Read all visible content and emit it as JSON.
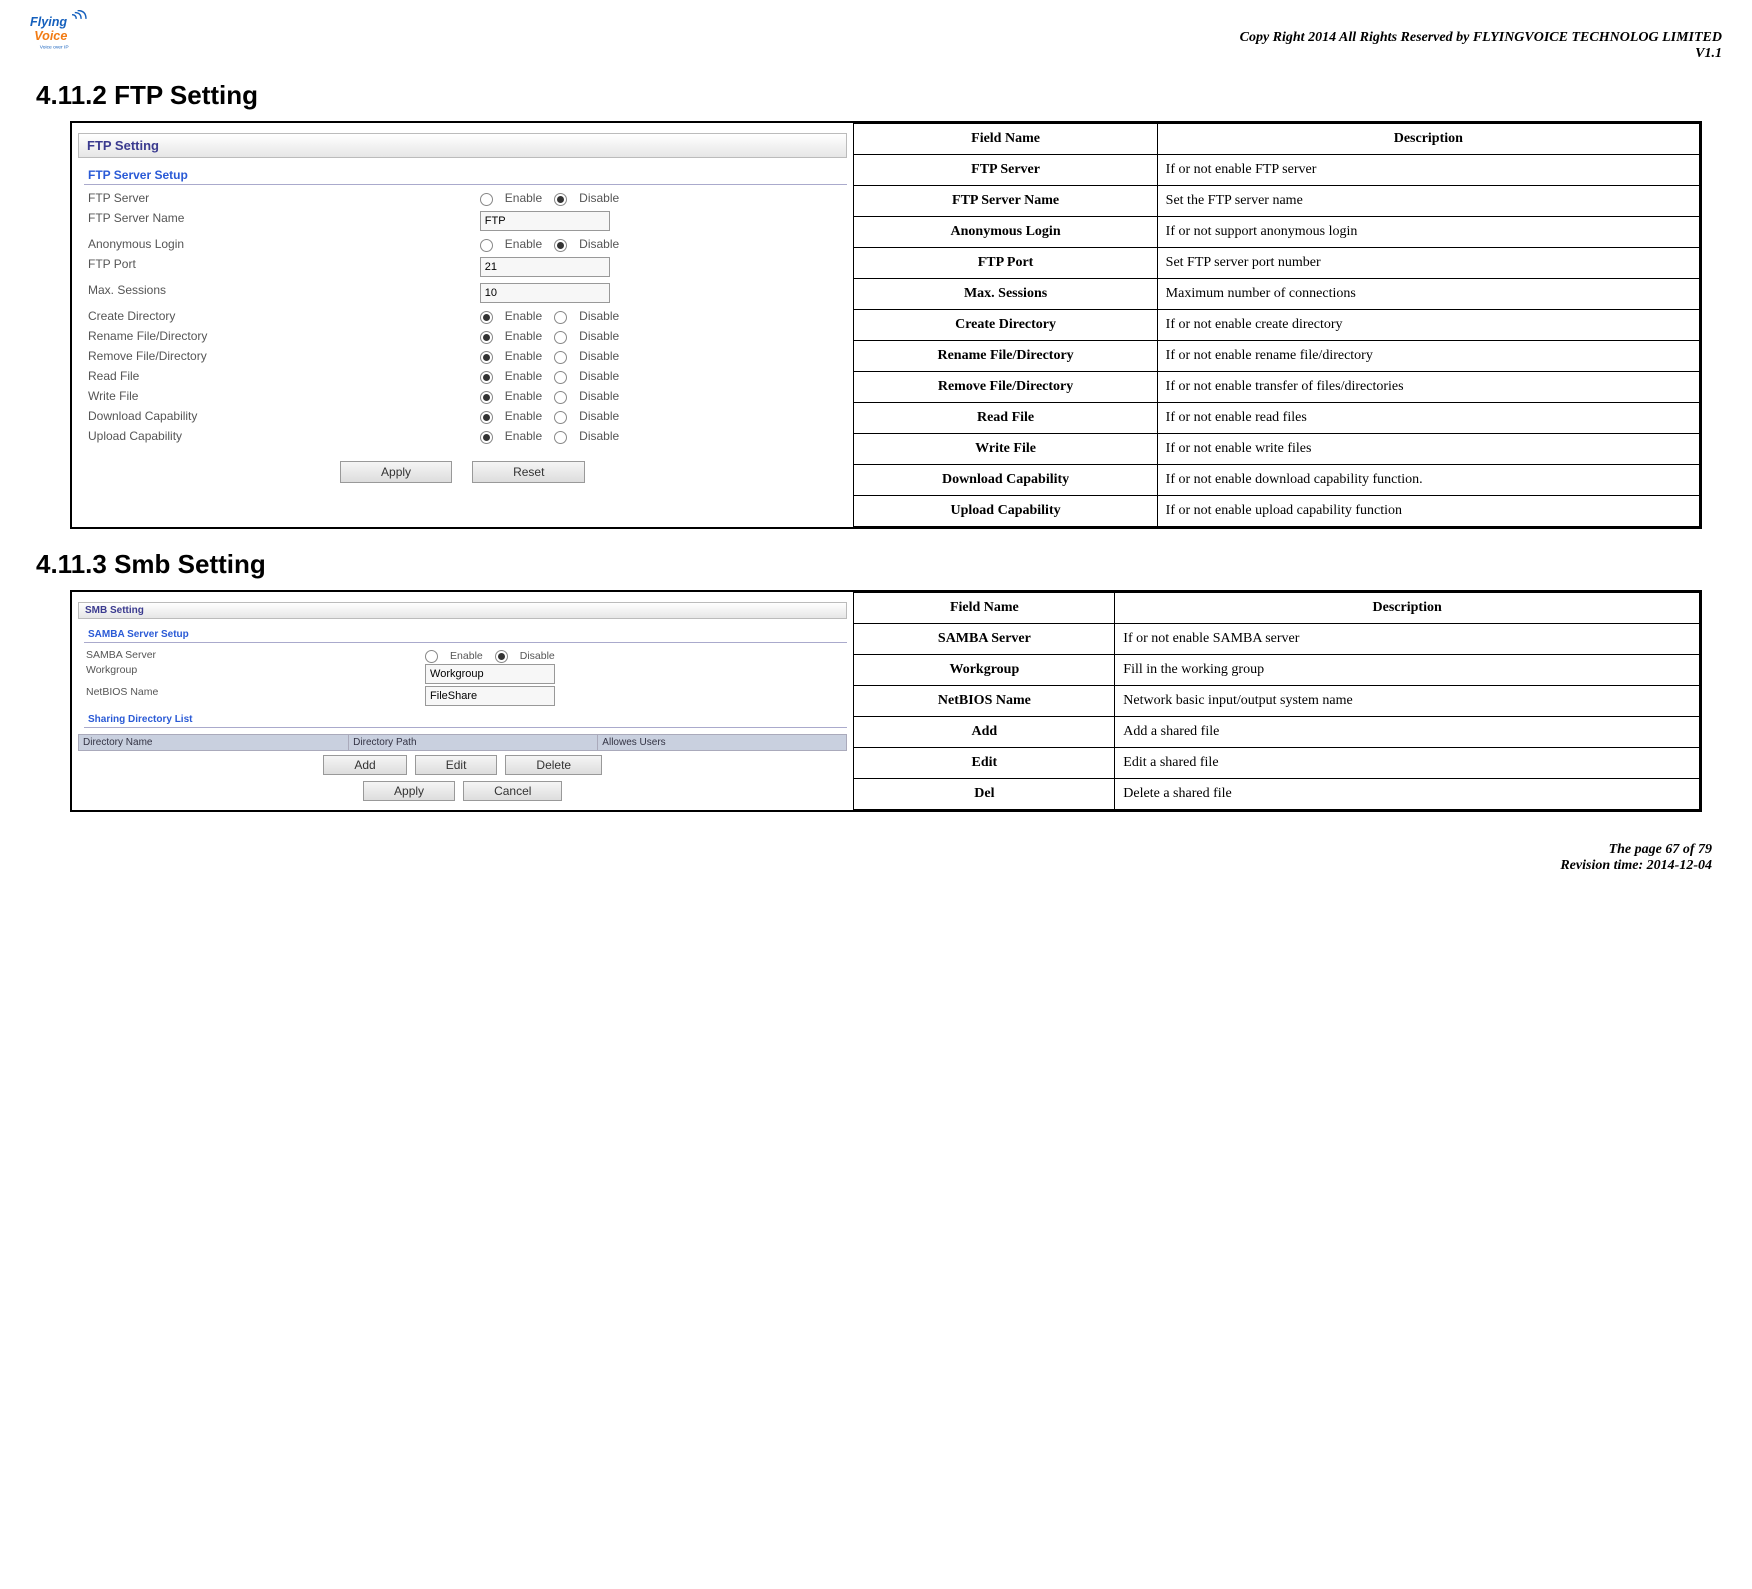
{
  "header": {
    "copyright": "Copy Right 2014 All Rights Reserved by FLYINGVOICE TECHNOLOG LIMITED",
    "version": "V1.1"
  },
  "section1": {
    "heading": "4.11.2  FTP Setting",
    "panel_title": "FTP Setting",
    "group_title": "FTP Server Setup",
    "rows": [
      {
        "label": "FTP Server",
        "enable": "Enable",
        "disable": "Disable",
        "type": "radio",
        "sel": "disable"
      },
      {
        "label": "FTP Server Name",
        "value": "FTP",
        "type": "text"
      },
      {
        "label": "Anonymous Login",
        "enable": "Enable",
        "disable": "Disable",
        "type": "radio",
        "sel": "disable"
      },
      {
        "label": "FTP Port",
        "value": "21",
        "type": "text"
      },
      {
        "label": "Max. Sessions",
        "value": "10",
        "type": "text"
      },
      {
        "label": "Create Directory",
        "enable": "Enable",
        "disable": "Disable",
        "type": "radio",
        "sel": "enable"
      },
      {
        "label": "Rename File/Directory",
        "enable": "Enable",
        "disable": "Disable",
        "type": "radio",
        "sel": "enable"
      },
      {
        "label": "Remove File/Directory",
        "enable": "Enable",
        "disable": "Disable",
        "type": "radio",
        "sel": "enable"
      },
      {
        "label": "Read File",
        "enable": "Enable",
        "disable": "Disable",
        "type": "radio",
        "sel": "enable"
      },
      {
        "label": "Write File",
        "enable": "Enable",
        "disable": "Disable",
        "type": "radio",
        "sel": "enable"
      },
      {
        "label": "Download Capability",
        "enable": "Enable",
        "disable": "Disable",
        "type": "radio",
        "sel": "enable"
      },
      {
        "label": "Upload Capability",
        "enable": "Enable",
        "disable": "Disable",
        "type": "radio",
        "sel": "enable"
      }
    ],
    "apply": "Apply",
    "reset": "Reset",
    "desc_header_field": "Field Name",
    "desc_header_desc": "Description",
    "desc_rows": [
      {
        "f": "FTP Server",
        "d": "If or not enable FTP server"
      },
      {
        "f": "FTP Server Name",
        "d": "Set the FTP server name"
      },
      {
        "f": "Anonymous Login",
        "d": "If or not support anonymous login"
      },
      {
        "f": "FTP Port",
        "d": "Set FTP server port number"
      },
      {
        "f": "Max. Sessions",
        "d": "Maximum number of connections"
      },
      {
        "f": "Create Directory",
        "d": "If or not enable create directory"
      },
      {
        "f": "Rename File/Directory",
        "d": "If or not enable rename file/directory"
      },
      {
        "f": "Remove File/Directory",
        "d": "If or not enable transfer of files/directories"
      },
      {
        "f": "Read File",
        "d": "If or not enable read files"
      },
      {
        "f": "Write File",
        "d": "If or not enable write files"
      },
      {
        "f": "Download Capability",
        "d": "If or not enable download capability function."
      },
      {
        "f": "Upload Capability",
        "d": "If or not enable upload capability function"
      }
    ]
  },
  "section2": {
    "heading": "4.11.3  Smb Setting",
    "panel_title": "SMB Setting",
    "group1": "SAMBA Server Setup",
    "rows": [
      {
        "label": "SAMBA Server",
        "enable": "Enable",
        "disable": "Disable",
        "type": "radio",
        "sel": "disable"
      },
      {
        "label": "Workgroup",
        "value": "Workgroup",
        "type": "text"
      },
      {
        "label": "NetBIOS Name",
        "value": "FileShare",
        "type": "text"
      }
    ],
    "group2": "Sharing Directory List",
    "dir_cols": [
      "Directory Name",
      "Directory Path",
      "Allowes Users"
    ],
    "add": "Add",
    "edit": "Edit",
    "del": "Delete",
    "apply": "Apply",
    "cancel": "Cancel",
    "desc_header_field": "Field Name",
    "desc_header_desc": "Description",
    "desc_rows": [
      {
        "f": "SAMBA Server",
        "d": "If or not enable SAMBA server"
      },
      {
        "f": "Workgroup",
        "d": "Fill in the working group"
      },
      {
        "f": "NetBIOS Name",
        "d": "Network basic input/output system name"
      },
      {
        "f": "Add",
        "d": "Add a shared file"
      },
      {
        "f": "Edit",
        "d": "Edit a shared file"
      },
      {
        "f": "Del",
        "d": "Delete a shared file"
      }
    ]
  },
  "footer": {
    "page": "The page 67 of 79",
    "rev": "Revision time: 2014-12-04"
  }
}
